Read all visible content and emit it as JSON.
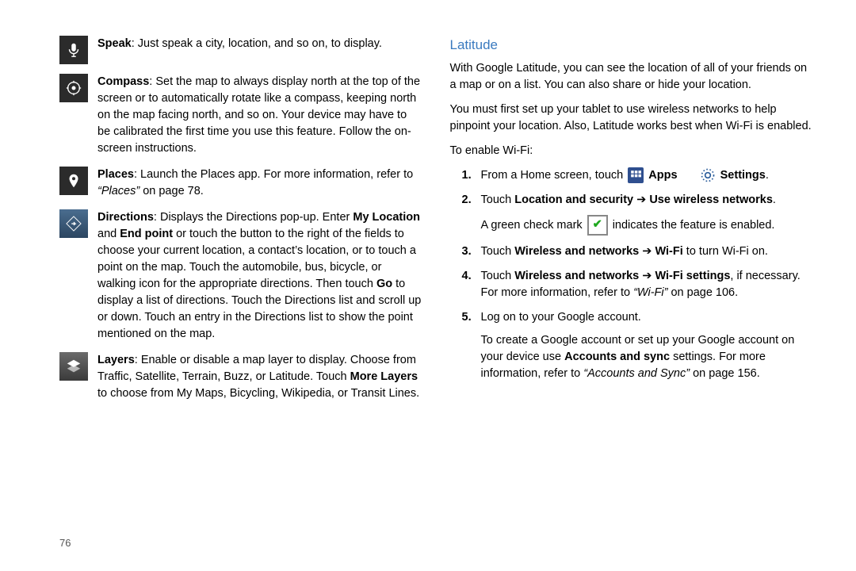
{
  "page_number": "76",
  "left": {
    "speak": {
      "label": "Speak",
      "text": ": Just speak a city, location, and so on, to display."
    },
    "compass": {
      "label": "Compass",
      "text": ": Set the map to always display north at the top of the screen or to automatically rotate like a compass, keeping north on the map facing north, and so on. Your device may have to be calibrated the first time you use this feature. Follow the on-screen instructions."
    },
    "places": {
      "label": "Places",
      "text1": ": Launch the Places app. For more information, refer to ",
      "ref": "“Places”",
      "text2": " on page 78."
    },
    "directions": {
      "label": "Directions",
      "t1": ": Displays the Directions pop-up. Enter ",
      "b1": "My Location",
      "t2": " and ",
      "b2": "End point",
      "t3": " or touch the button to the right of the fields to choose your current location, a contact’s location, or to touch a point on the map. Touch the automobile, bus, bicycle, or walking icon for the appropriate directions. Then touch ",
      "b3": "Go",
      "t4": " to display a list of directions. Touch the Directions list and scroll up or down. Touch an entry in the Directions list to show the point mentioned on the map."
    },
    "layers": {
      "label": "Layers",
      "t1": ": Enable or disable a map layer to display. Choose from Traffic, Satellite, Terrain, Buzz, or Latitude. Touch ",
      "b1": "More Layers",
      "t2": " to choose from My Maps, Bicycling, Wikipedia, or Transit Lines."
    }
  },
  "right": {
    "heading": "Latitude",
    "p1": "With Google Latitude, you can see the location of all of your friends on a map or on a list. You can also share or hide your location.",
    "p2": "You must first set up your tablet to use wireless networks to help pinpoint your location. Also, Latitude works best when Wi-Fi is enabled.",
    "p3": "To enable Wi-Fi:",
    "steps": {
      "n1": "1.",
      "s1a": "From a Home screen, touch ",
      "s1_apps": "Apps",
      "s1_settings": "Settings",
      "s1_dot": ".",
      "n2": "2.",
      "s2a": "Touch ",
      "s2b": "Location and security",
      "s2_arrow": " ➔ ",
      "s2c": "Use wireless networks",
      "s2_dot": ".",
      "s2_after_a": "A green check mark ",
      "s2_after_b": " indicates the feature is enabled.",
      "n3": "3.",
      "s3a": "Touch ",
      "s3b": "Wireless and networks",
      "s3_arrow": " ➔ ",
      "s3c": "Wi-Fi",
      "s3d": " to turn Wi-Fi on.",
      "n4": "4.",
      "s4a": "Touch ",
      "s4b": "Wireless and networks",
      "s4_arrow": " ➔ ",
      "s4c": "Wi-Fi settings",
      "s4d": ", if necessary. For more information, refer to ",
      "s4ref": "“Wi-Fi”",
      "s4e": " on page 106.",
      "n5": "5.",
      "s5a": "Log on to your Google account.",
      "s5_after_a": "To create a Google account or set up your Google account on your device use ",
      "s5_after_b": "Accounts and sync",
      "s5_after_c": " settings. For more information, refer to ",
      "s5_after_ref": "“Accounts and Sync”",
      "s5_after_d": " on page 156."
    }
  }
}
